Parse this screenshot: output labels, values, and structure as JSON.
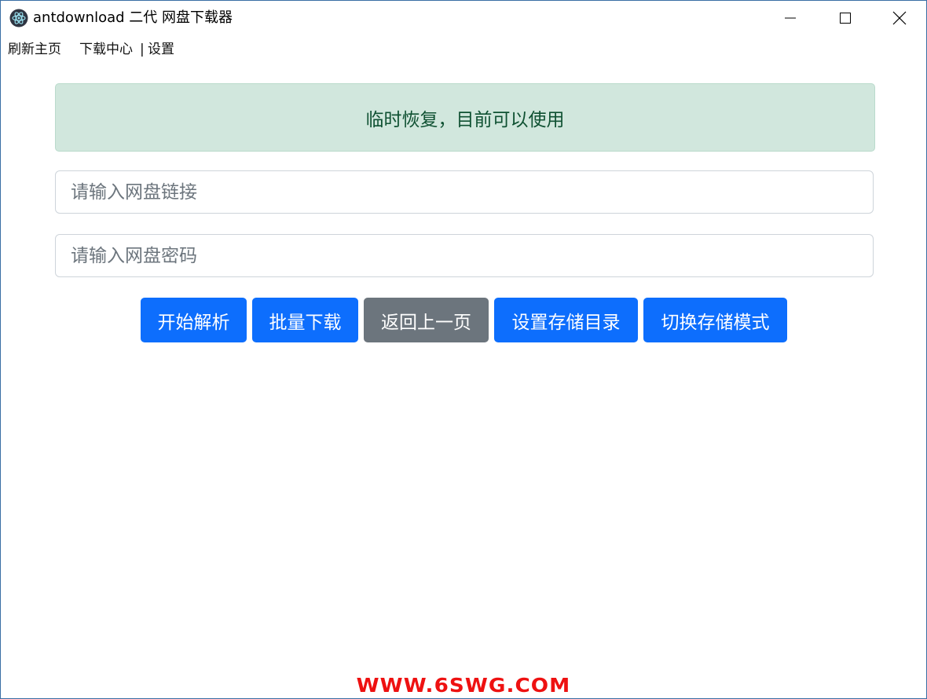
{
  "window": {
    "title": "antdownload 二代 网盘下载器",
    "icon": "electron-atom-icon",
    "controls": [
      "minimize-icon",
      "maximize-icon",
      "close-icon"
    ]
  },
  "menu": {
    "refresh": "刷新主页",
    "download_center": "下载中心",
    "separator": "|",
    "settings": "设置"
  },
  "alert": {
    "text": "临时恢复，目前可以使用",
    "color": "#d1e7dd"
  },
  "inputs": {
    "link_placeholder": "请输入网盘链接",
    "link_value": "",
    "password_placeholder": "请输入网盘密码",
    "password_value": ""
  },
  "buttons": {
    "parse": "开始解析",
    "batch_download": "批量下载",
    "back": "返回上一页",
    "set_dir": "设置存储目录",
    "switch_mode": "切换存储模式"
  },
  "colors": {
    "primary": "#0d6efd",
    "secondary": "#6c757d",
    "watermark": "#ee1111"
  },
  "watermark": "WWW.6SWG.COM"
}
